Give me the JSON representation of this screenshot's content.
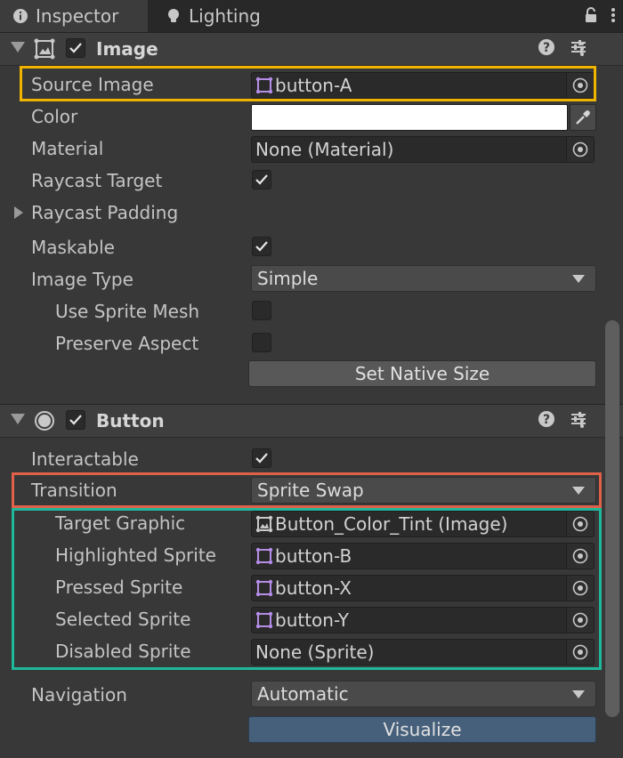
{
  "tabs": [
    {
      "label": "Inspector",
      "icon": "info-icon",
      "active": true
    },
    {
      "label": "Lighting",
      "icon": "lightbulb-icon",
      "active": false
    }
  ],
  "image_component": {
    "title": "Image",
    "enabled": true,
    "source_image": {
      "label": "Source Image",
      "value": "button-A"
    },
    "color": {
      "label": "Color",
      "value": "#ffffff"
    },
    "material": {
      "label": "Material",
      "value": "None (Material)"
    },
    "raycast_target": {
      "label": "Raycast Target",
      "checked": true
    },
    "raycast_padding": {
      "label": "Raycast Padding"
    },
    "maskable": {
      "label": "Maskable",
      "checked": true
    },
    "image_type": {
      "label": "Image Type",
      "value": "Simple"
    },
    "use_sprite_mesh": {
      "label": "Use Sprite Mesh",
      "checked": false
    },
    "preserve_aspect": {
      "label": "Preserve Aspect",
      "checked": false
    },
    "set_native_size": "Set Native Size"
  },
  "button_component": {
    "title": "Button",
    "enabled": true,
    "interactable": {
      "label": "Interactable",
      "checked": true
    },
    "transition": {
      "label": "Transition",
      "value": "Sprite Swap"
    },
    "target_graphic": {
      "label": "Target Graphic",
      "value": "Button_Color_Tint (Image)"
    },
    "highlighted_sprite": {
      "label": "Highlighted Sprite",
      "value": "button-B"
    },
    "pressed_sprite": {
      "label": "Pressed Sprite",
      "value": "button-X"
    },
    "selected_sprite": {
      "label": "Selected Sprite",
      "value": "button-Y"
    },
    "disabled_sprite": {
      "label": "Disabled Sprite",
      "value": "None (Sprite)"
    },
    "navigation": {
      "label": "Navigation",
      "value": "Automatic"
    },
    "visualize": "Visualize"
  },
  "highlight_colors": {
    "source_image": "#f0b400",
    "transition": "#e0604a",
    "sprites": "#1fb89a"
  }
}
